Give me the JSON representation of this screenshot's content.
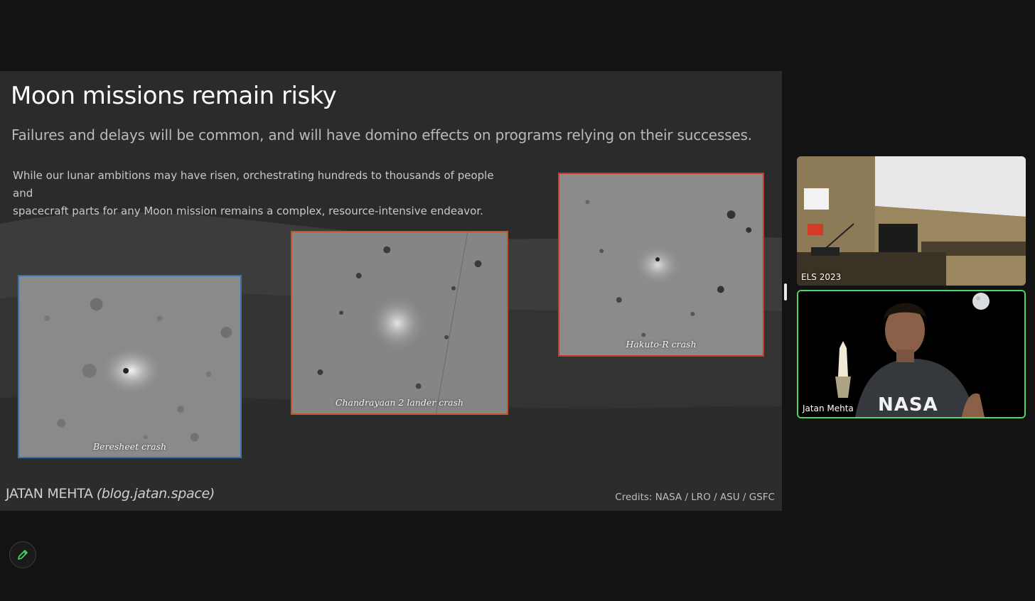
{
  "slide": {
    "title": "Moon missions remain risky",
    "subtitle": "Failures and delays will be common, and will have domino effects on programs relying on their successes.",
    "body_line1": "While our lunar ambitions may have risen, orchestrating hundreds to thousands of people and",
    "body_line2": "spacecraft parts for any Moon mission remains a complex, resource-intensive endeavor.",
    "photos": [
      {
        "caption": "Beresheet crash",
        "border_color": "#3a6fb0"
      },
      {
        "caption": "Chandrayaan 2 lander crash",
        "border_color": "#c0552a"
      },
      {
        "caption": "Hakuto-R crash",
        "border_color": "#c73a32"
      }
    ],
    "footer_author": "JATAN MEHTA",
    "footer_blog": "(blog.jatan.space)",
    "credits": "Credits: NASA / LRO / ASU / GSFC"
  },
  "video_tiles": [
    {
      "label": "ELS 2023"
    },
    {
      "label": "Jatan Mehta",
      "active_border": "#4fd66a",
      "shirt_text": "NASA"
    }
  ],
  "toolbar": {
    "annotate_icon": "pencil-icon",
    "accent": "#4fd66a"
  }
}
